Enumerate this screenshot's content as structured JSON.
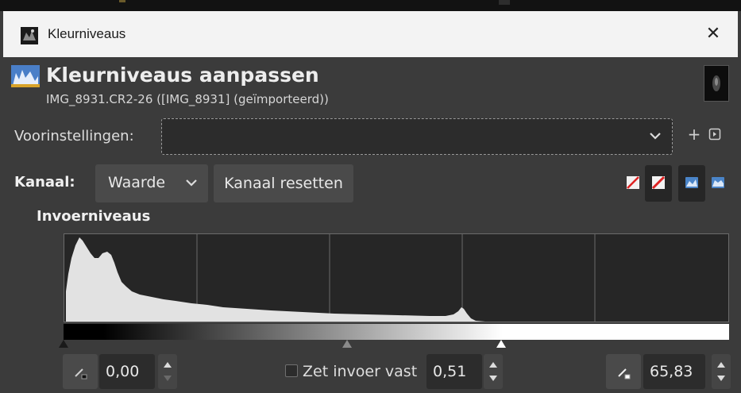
{
  "window": {
    "title": "Kleurniveaus",
    "close_glyph": "✕",
    "app_icon": "gimp-icon"
  },
  "header": {
    "title": "Kleurniveaus aanpassen",
    "subtitle": "IMG_8931.CR2-26 ([IMG_8931] (geïmporteerd))",
    "icon": "levels-icon",
    "thumbnail": "image-thumbnail"
  },
  "presets": {
    "label": "Voorinstellingen:",
    "value": "",
    "add_glyph": "+",
    "menu_icon": "preset-menu-icon"
  },
  "channel": {
    "label": "Kanaal:",
    "value": "Waarde",
    "reset_label": "Kanaal resetten",
    "tools": [
      "linear-histogram-icon",
      "logarithmic-histogram-icon",
      "linear-view-icon",
      "log-view-icon"
    ]
  },
  "input_levels": {
    "label": "Invoerniveaus",
    "low": "0,00",
    "gamma": "0,51",
    "high": "65,83",
    "clamp_label": "Zet invoer vast",
    "clamp_checked": false,
    "slider_positions": {
      "low": 0.0,
      "gamma": 0.426,
      "high": 0.658
    }
  },
  "colors": {
    "background": "#3b3b3b",
    "histogram_fill": "#e2e2e2",
    "field": "#2c2c2c",
    "button": "#4a4a4a"
  }
}
